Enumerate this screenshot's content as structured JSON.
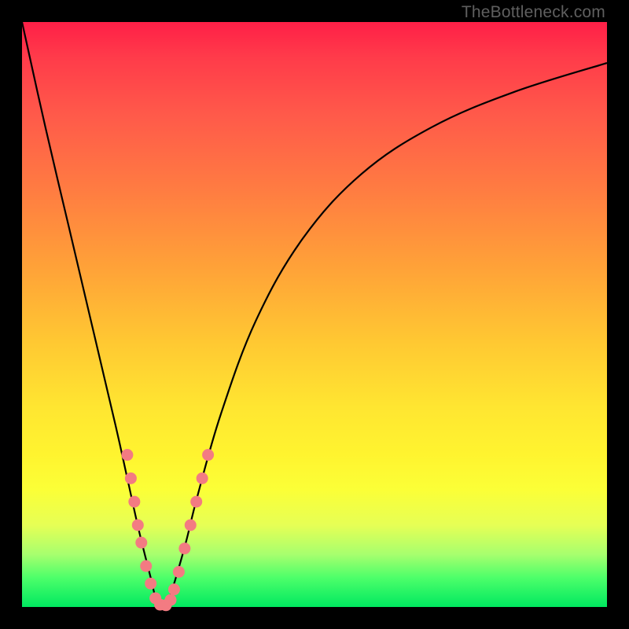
{
  "watermark": "TheBottleneck.com",
  "chart_data": {
    "type": "line",
    "title": "",
    "xlabel": "",
    "ylabel": "",
    "xlim": [
      0,
      100
    ],
    "ylim": [
      0,
      100
    ],
    "grid": false,
    "series": [
      {
        "name": "bottleneck-curve",
        "x": [
          0,
          4,
          8,
          12,
          16,
          18,
          20,
          22,
          23,
          24,
          25,
          26,
          28,
          30,
          34,
          40,
          48,
          58,
          70,
          84,
          100
        ],
        "y": [
          100,
          82,
          65,
          48,
          31,
          22,
          13,
          5,
          1,
          0,
          1,
          4,
          11,
          19,
          33,
          49,
          63,
          74,
          82,
          88,
          93
        ]
      }
    ],
    "markers": [
      {
        "name": "highlight-dots",
        "points": [
          {
            "x": 18.0,
            "y": 26
          },
          {
            "x": 18.6,
            "y": 22
          },
          {
            "x": 19.2,
            "y": 18
          },
          {
            "x": 19.8,
            "y": 14
          },
          {
            "x": 20.4,
            "y": 11
          },
          {
            "x": 21.2,
            "y": 7
          },
          {
            "x": 22.0,
            "y": 4
          },
          {
            "x": 22.8,
            "y": 1.5
          },
          {
            "x": 23.6,
            "y": 0.4
          },
          {
            "x": 24.6,
            "y": 0.3
          },
          {
            "x": 25.4,
            "y": 1.2
          },
          {
            "x": 26.0,
            "y": 3
          },
          {
            "x": 26.8,
            "y": 6
          },
          {
            "x": 27.8,
            "y": 10
          },
          {
            "x": 28.8,
            "y": 14
          },
          {
            "x": 29.8,
            "y": 18
          },
          {
            "x": 30.8,
            "y": 22
          },
          {
            "x": 31.8,
            "y": 26
          }
        ]
      }
    ],
    "colors": {
      "curve": "#000000",
      "markers": "#f37b82"
    }
  }
}
